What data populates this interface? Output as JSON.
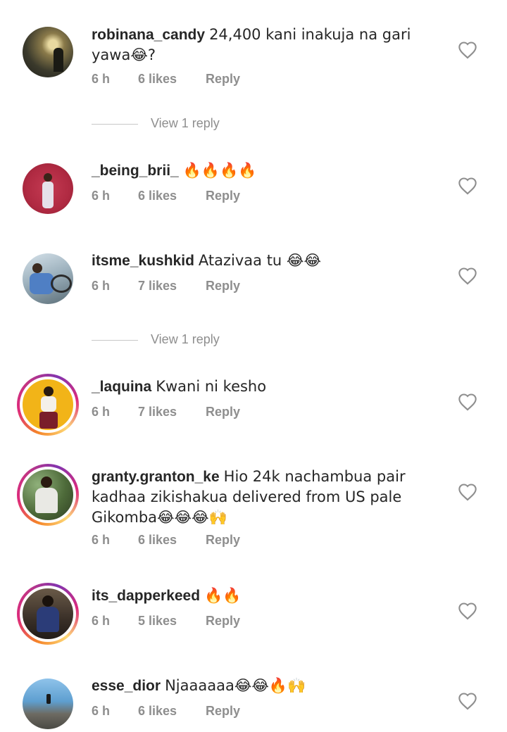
{
  "comments": [
    {
      "username": "robinana_candy",
      "text": "24,400 kani inakuja na gari yawa😂?",
      "time": "6 h",
      "likes": "6 likes",
      "reply": "Reply",
      "view_replies": "View 1 reply"
    },
    {
      "username": "_being_brii_",
      "text": "🔥🔥🔥🔥",
      "time": "6 h",
      "likes": "6 likes",
      "reply": "Reply"
    },
    {
      "username": "itsme_kushkid",
      "text": "Atazivaa tu 😂😂",
      "time": "6 h",
      "likes": "7 likes",
      "reply": "Reply",
      "view_replies": "View 1 reply"
    },
    {
      "username": "_laquina",
      "text": "Kwani ni kesho",
      "time": "6 h",
      "likes": "7 likes",
      "reply": "Reply"
    },
    {
      "username": "granty.granton_ke",
      "text": "Hio 24k nachambua pair kadhaa zikishakua delivered from US pale Gikomba😂😂😂🙌",
      "time": "6 h",
      "likes": "6 likes",
      "reply": "Reply"
    },
    {
      "username": "its_dapperkeed",
      "text": "🔥🔥",
      "time": "6 h",
      "likes": "5 likes",
      "reply": "Reply"
    },
    {
      "username": "esse_dior",
      "text": "Njaaaaaa😂😂🔥🙌",
      "time": "6 h",
      "likes": "6 likes",
      "reply": "Reply"
    }
  ]
}
